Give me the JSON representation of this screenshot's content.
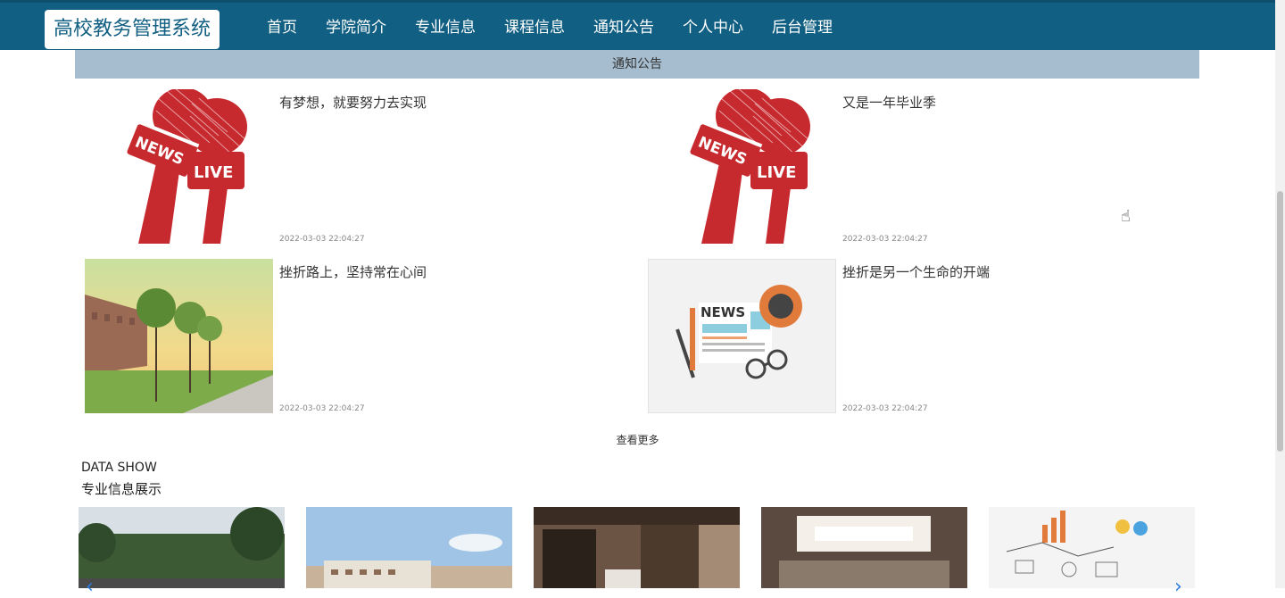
{
  "header": {
    "logo": "高校教务管理系统",
    "nav": [
      "首页",
      "学院简介",
      "专业信息",
      "课程信息",
      "通知公告",
      "个人中心",
      "后台管理"
    ]
  },
  "notice": {
    "section_title": "通知公告",
    "items": [
      {
        "title": "有梦想，就要努力去实现",
        "date": "2022-03-03 22:04:27",
        "image": "news-live-microphone"
      },
      {
        "title": "又是一年毕业季",
        "date": "2022-03-03 22:04:27",
        "image": "news-live-microphone"
      },
      {
        "title": "挫折路上，坚持常在心间",
        "date": "2022-03-03 22:04:27",
        "image": "campus-trees-photo"
      },
      {
        "title": "挫折是另一个生命的开端",
        "date": "2022-03-03 22:04:27",
        "image": "news-paper-illustration"
      }
    ],
    "more_label": "查看更多"
  },
  "data_show": {
    "title": "DATA SHOW",
    "subtitle": "专业信息展示",
    "cards": [
      "campus-trees-photo",
      "campus-building-photo",
      "dormitory-bunk-photo",
      "office-interior-photo",
      "idea-sketch-photo"
    ]
  },
  "colors": {
    "header_bg": "#115f82",
    "section_bar": "#a5bdcf",
    "mic_red": "#c62a2f"
  }
}
